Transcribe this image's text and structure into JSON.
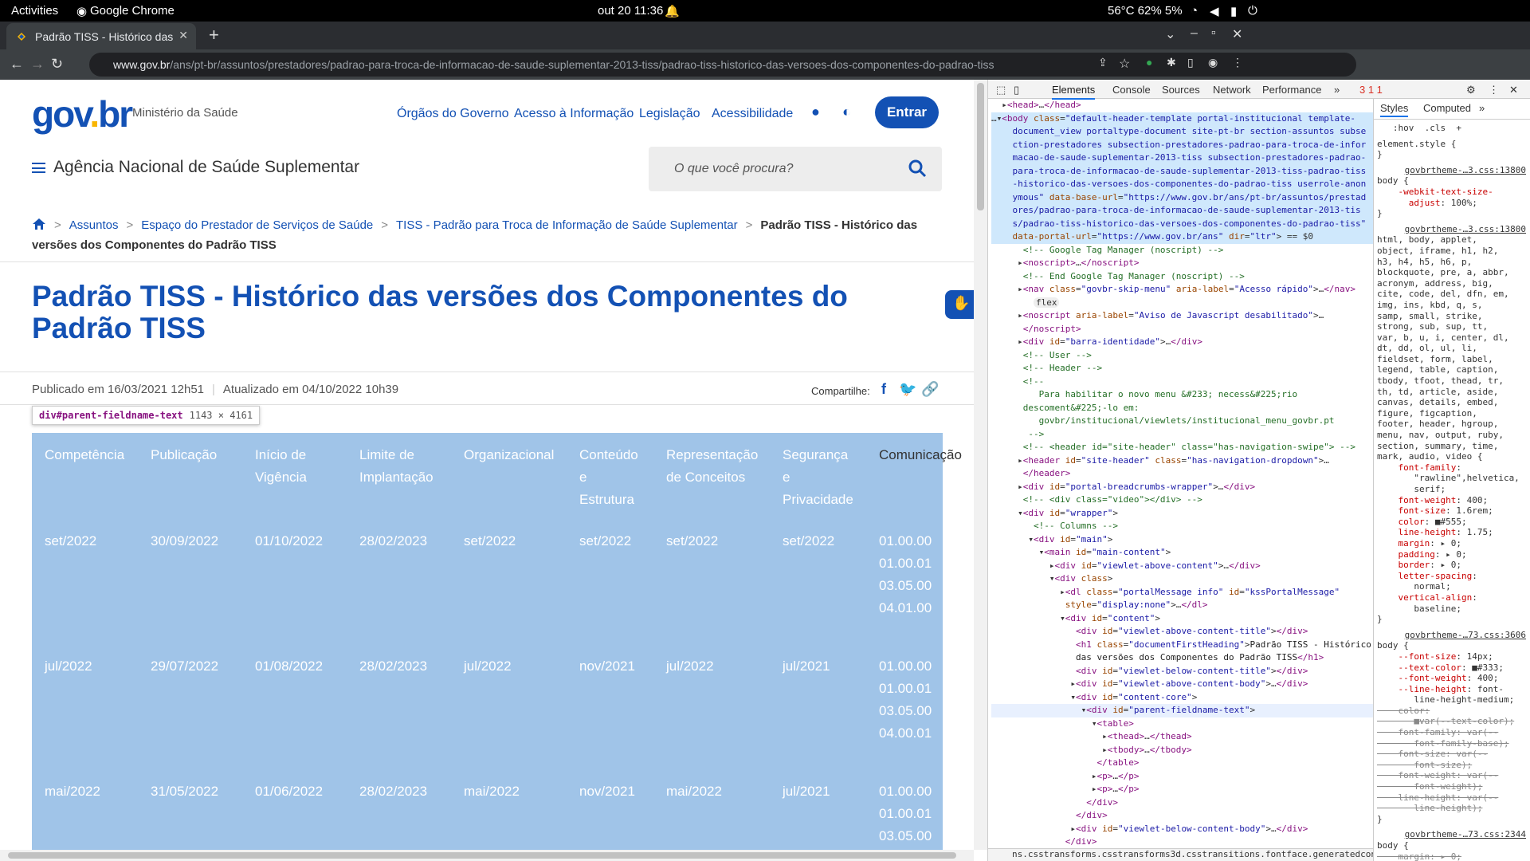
{
  "os": {
    "activities": "Activities",
    "app": "Google Chrome",
    "clock": "out 20  11:36",
    "status": "56°C 62% 5%"
  },
  "browser": {
    "tab_title": "Padrão TISS - Histórico das",
    "url_host": "www.gov.br",
    "url_path": "/ans/pt-br/assuntos/prestadores/padrao-para-troca-de-informacao-de-saude-suplementar-2013-tiss/padrao-tiss-historico-das-versoes-dos-componentes-do-padrao-tiss"
  },
  "site": {
    "logo_gov": "gov",
    "logo_dot": ".",
    "logo_br": "br",
    "ministry": "Ministério da Saúde",
    "top_links": [
      "Órgãos do Governo",
      "Acesso à Informação",
      "Legislação",
      "Acessibilidade"
    ],
    "login": "Entrar",
    "agency": "Agência Nacional de Saúde Suplementar",
    "search_placeholder": "O que você procura?"
  },
  "breadcrumb": [
    "Assuntos",
    "Espaço do Prestador de Serviços de Saúde",
    "TISS - Padrão para Troca de Informação de Saúde Suplementar"
  ],
  "breadcrumb_current": "Padrão TISS - Histórico das versões dos Componentes do Padrão TISS",
  "title": "Padrão TISS - Histórico das versões dos Componentes do Padrão TISS",
  "published": "Publicado em 16/03/2021 12h51",
  "updated": "Atualizado em 04/10/2022 10h39",
  "share_label": "Compartilhe:",
  "inspector_tooltip": {
    "name": "div#parent-fieldname-text",
    "size": "1143 × 4161"
  },
  "table": {
    "headers": [
      "Competência",
      "Publicação",
      "Início de\nVigência",
      "Limite de\nImplantação",
      "Organizacional",
      "Conteúdo\ne\nEstrutura",
      "Representação\nde Conceitos",
      "Segurança\ne\nPrivacidade",
      "Comunicação"
    ],
    "rows": [
      [
        "set/2022",
        "30/09/2022",
        "01/10/2022",
        "28/02/2023",
        "set/2022",
        "set/2022",
        "set/2022",
        "set/2022",
        "01.00.00\n01.00.01\n03.05.00\n04.01.00"
      ],
      [
        "jul/2022",
        "29/07/2022",
        "01/08/2022",
        "28/02/2023",
        "jul/2022",
        "nov/2021",
        "jul/2022",
        "jul/2021",
        "01.00.00\n01.00.01\n03.05.00\n04.00.01"
      ],
      [
        "mai/2022",
        "31/05/2022",
        "01/06/2022",
        "28/02/2023",
        "mai/2022",
        "nov/2021",
        "mai/2022",
        "jul/2021",
        "01.00.00\n01.00.01\n03.05.00"
      ]
    ]
  },
  "devtools": {
    "tabs": [
      "Elements",
      "Console",
      "Sources",
      "Network",
      "Performance"
    ],
    "issues": "3  1  1",
    "styles_tabs": [
      "Styles",
      "Computed"
    ],
    "breadcrumb_path": "ns.csstransforms.csstransforms3d.csstransitions.fontface.generatedcontent.vic"
  }
}
